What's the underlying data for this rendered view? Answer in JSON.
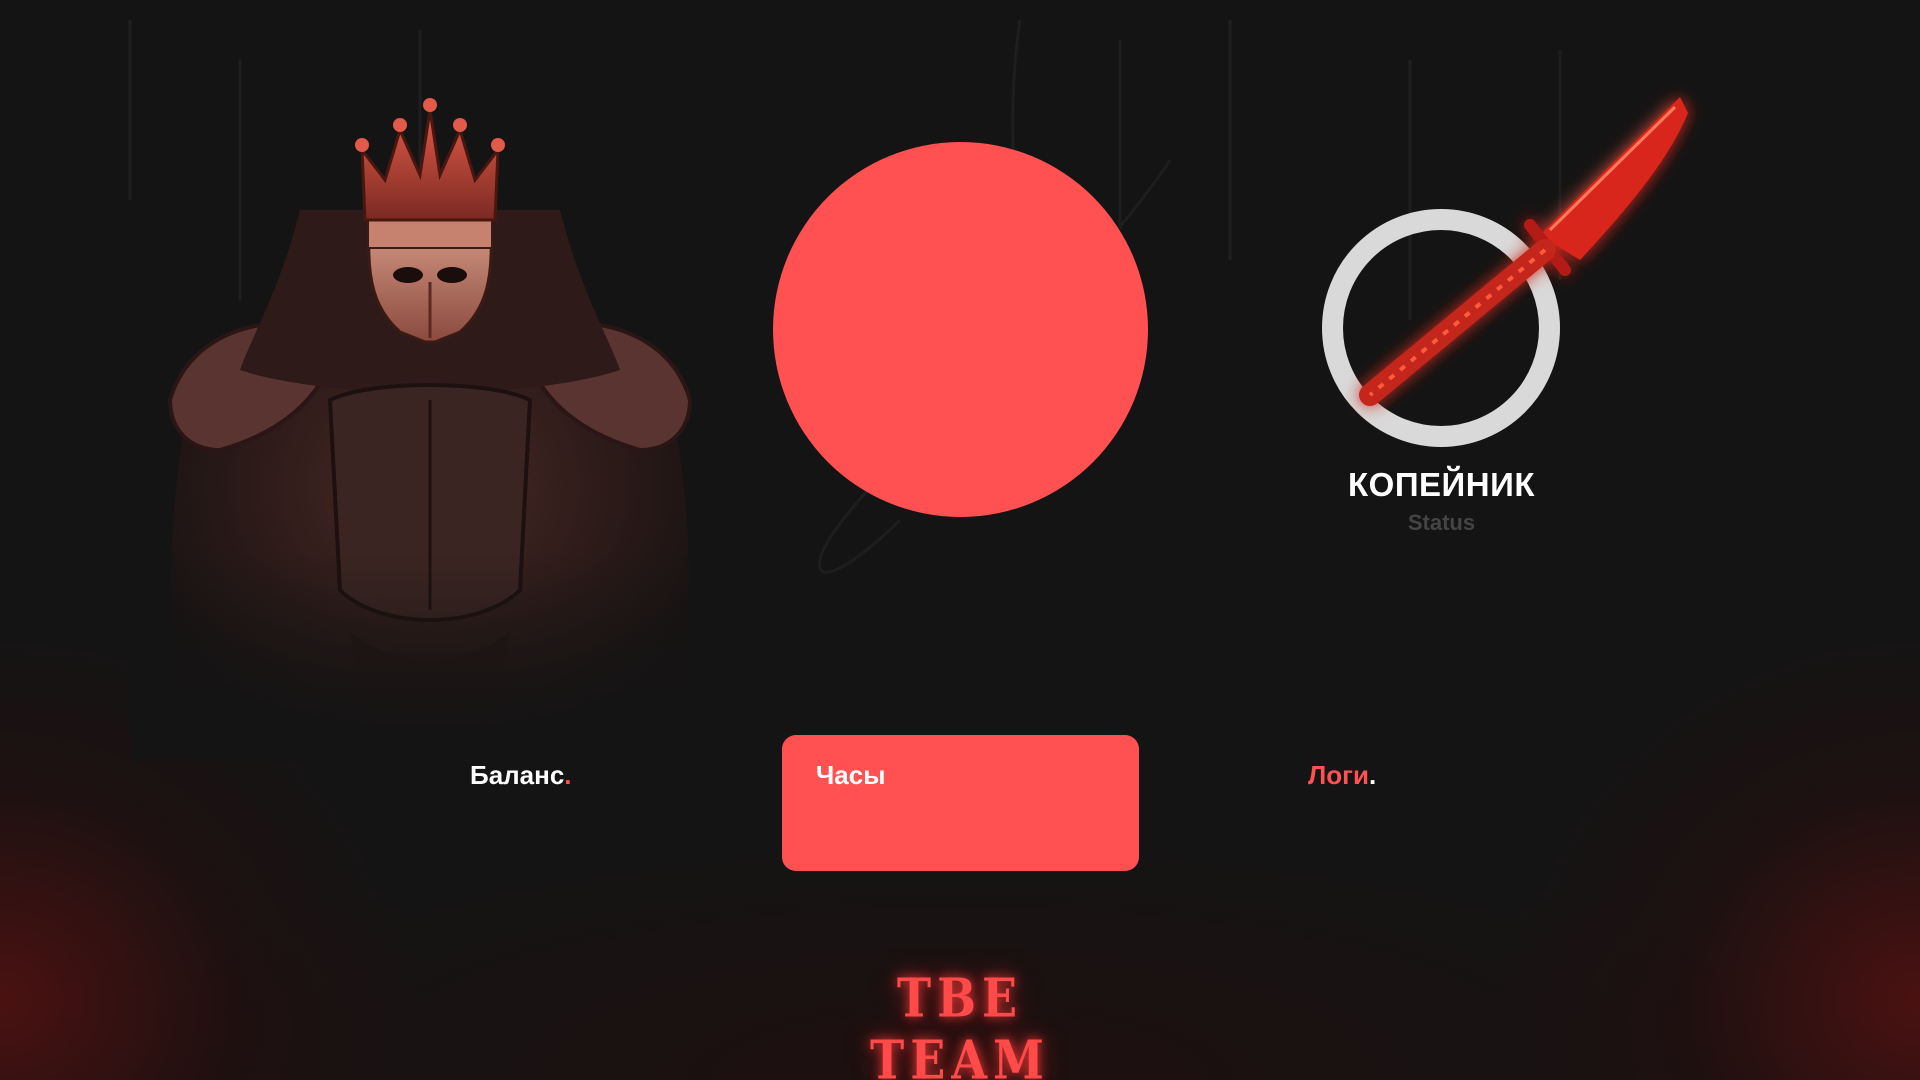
{
  "status": {
    "title": "КОПЕЙНИК",
    "subtitle": "Status"
  },
  "tabs": [
    {
      "label": "Баланс",
      "dot": ".",
      "active": false
    },
    {
      "label": "Часы",
      "active": true
    },
    {
      "label": "Логи",
      "dot": ".",
      "active": false
    }
  ],
  "logo": {
    "text": "TBE TEAM"
  },
  "icons": {
    "knight": "crowned-knight-illustration",
    "avatar": "avatar-placeholder-circle",
    "status_badge": "knife-icon"
  },
  "colors": {
    "accent": "#ff5151",
    "background": "#141414",
    "ring": "#d9d9d9",
    "muted_text": "#444444",
    "text": "#ffffff"
  }
}
